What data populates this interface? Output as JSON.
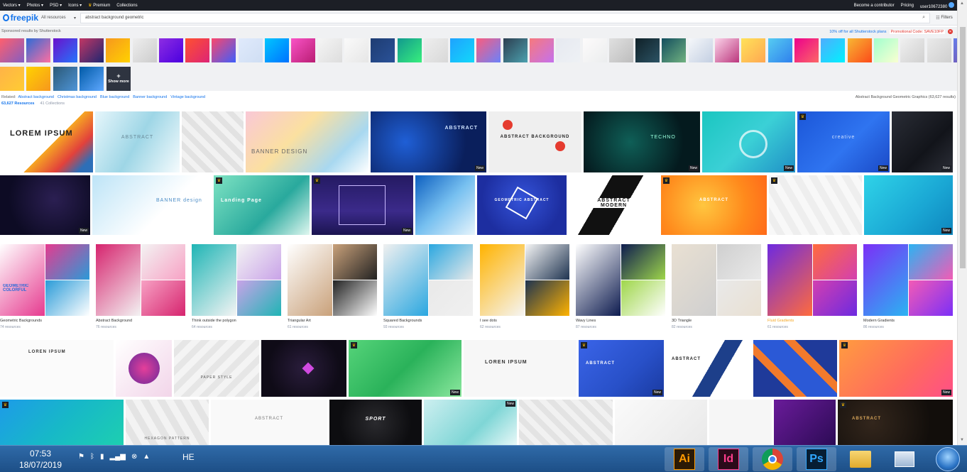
{
  "topnav": {
    "items": [
      "Vectors",
      "Photos",
      "PSD",
      "Icons",
      "Premium",
      "Collections"
    ],
    "contributor": "Become a contributor",
    "pricing": "Pricing",
    "user": "user10672380"
  },
  "search": {
    "logo": "freepik",
    "resource_type": "All resources",
    "query": "abstract background geometric",
    "filters_label": "Filters"
  },
  "sponsored": {
    "label": "Sponsored results by Shutterstock",
    "offer": "10% off for all Shutterstock plans",
    "promo": "Promotional Code: SAVE10FP",
    "show_more": "Show more"
  },
  "related": {
    "label": "Related:",
    "tags": [
      "Abstract background",
      "Christmas background",
      "Blue background",
      "Banner background",
      "Vintage background"
    ],
    "total": "Abstract Background Geometric Graphics (63,627 results)"
  },
  "counts": {
    "resources": "63,627 Resources",
    "collections": "41 Collections"
  },
  "tile_texts": {
    "lorem": "LOREM IPSUM",
    "abstract": "ABSTRACT",
    "banner_design": "BANNER DESIGN",
    "abstract_background": "ABSTRACT BACKGROUND",
    "techno": "TECHNO",
    "creative": "creative",
    "banner": "BANNER design",
    "landing": "Landing Page",
    "geometric": "GEOMETRIC ABSTRACT",
    "modern": "ABSTRACT MODERN",
    "sport": "SPORT",
    "hexagon": "HEXAGON PATTERN",
    "paper": "PAPER STYLE",
    "loren": "LOREN IPSUM",
    "geom_colorful": "GEOMETRIC COLORFUL",
    "new": "New"
  },
  "collections": [
    {
      "name": "Geometric Backgrounds",
      "count": "74 resources"
    },
    {
      "name": "Abstract Background",
      "count": "76 resources"
    },
    {
      "name": "Think outside the polygon",
      "count": "64 resources"
    },
    {
      "name": "Triangular Art",
      "count": "61 resources"
    },
    {
      "name": "Squared Backgrounds",
      "count": "93 resources"
    },
    {
      "name": "I see dots",
      "count": "62 resources"
    },
    {
      "name": "Wavy Lines",
      "count": "87 resources"
    },
    {
      "name": "3D Triangle",
      "count": "82 resources"
    },
    {
      "name": "Fluid Gradients",
      "count": "61 resources"
    },
    {
      "name": "Modern Gradients",
      "count": "86 resources"
    }
  ],
  "taskbar": {
    "time": "07:53",
    "date": "18/07/2019",
    "language": "HE",
    "apps": [
      "Ai",
      "Id",
      "Chrome",
      "Ps",
      "Explorer",
      "Network"
    ]
  }
}
